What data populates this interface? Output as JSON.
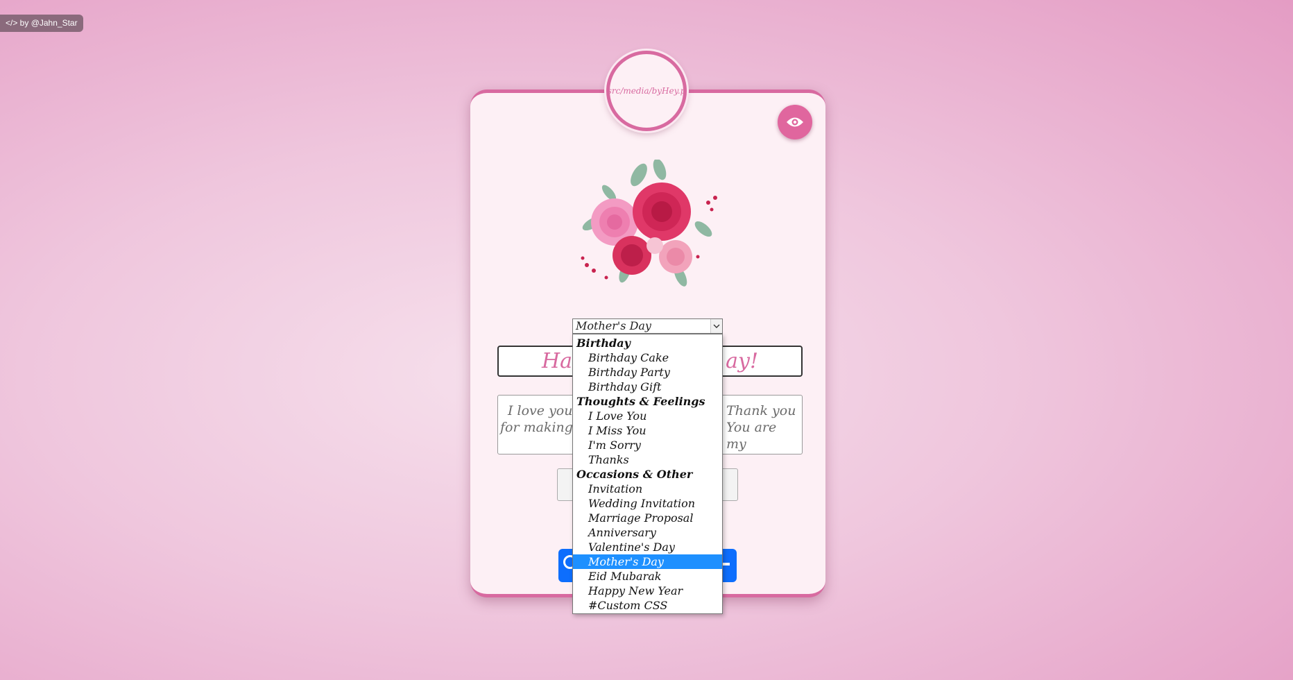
{
  "credit": {
    "label": "</> by @Jahn_Star"
  },
  "avatar": {
    "text": "src/media/byHey.p"
  },
  "occasion_select": {
    "selected": "Mother's Day",
    "groups": [
      {
        "label": "Birthday",
        "options": [
          "Birthday Cake",
          "Birthday Party",
          "Birthday Gift"
        ]
      },
      {
        "label": "Thoughts & Feelings",
        "options": [
          "I Love You",
          "I Miss You",
          "I'm Sorry",
          "Thanks"
        ]
      },
      {
        "label": "Occasions & Other",
        "options": [
          "Invitation",
          "Wedding Invitation",
          "Marriage Proposal",
          "Anniversary",
          "Valentine's Day",
          "Mother's Day",
          "Eid Mubarak",
          "Happy New Year",
          "#Custom CSS"
        ]
      }
    ]
  },
  "card": {
    "title_left": "Ha",
    "title_right": "ay!",
    "message_left_1": "I love you n",
    "message_left_2": "for making n",
    "message_right_1": "Thank you",
    "message_right_2": "You are my"
  },
  "icons": {
    "preview": "eye-icon",
    "chevron": "chevron-down-icon"
  },
  "colors": {
    "accent": "#d86aa0",
    "button_blue": "#0d6efd",
    "selected_option": "#1e90ff"
  }
}
